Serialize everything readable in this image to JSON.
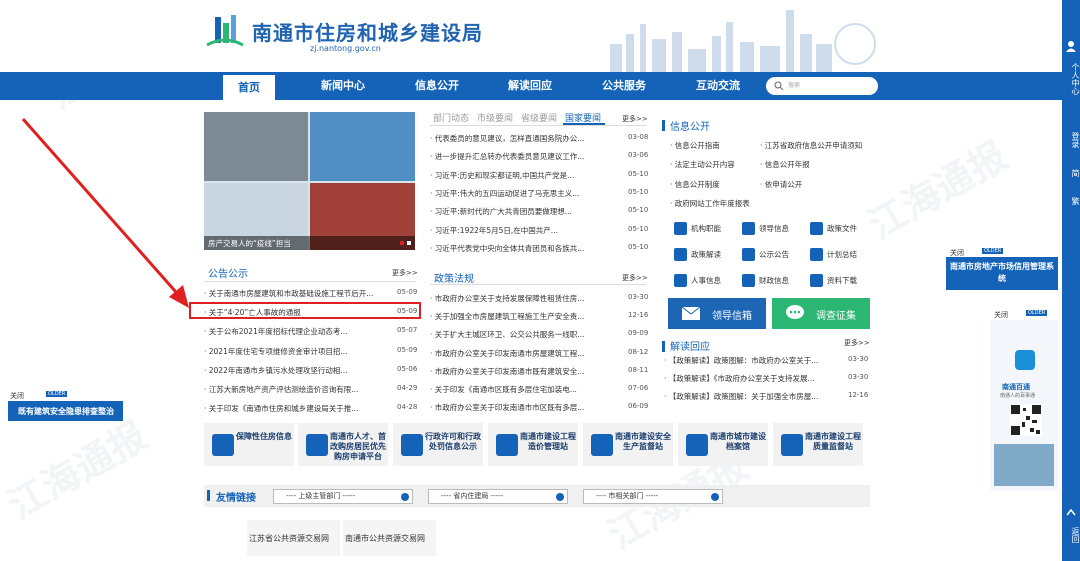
{
  "header": {
    "title": "南通市住房和城乡建设局",
    "domain": "zj.nantong.gov.cn"
  },
  "nav": {
    "items": [
      "首页",
      "新闻中心",
      "信息公开",
      "解读回应",
      "公共服务",
      "互动交流"
    ],
    "search_placeholder": "搜索"
  },
  "rail": {
    "user_center": "个人中心",
    "login": "登录",
    "simplified": "简",
    "traditional": "繁",
    "back": "返回"
  },
  "slider": {
    "caption": "房产交易人的“疫线”担当"
  },
  "notices": {
    "title": "公告公示",
    "more": "更多>>",
    "items": [
      {
        "text": "关于南通市房屋建筑和市政基础设施工程节后开...",
        "date": "05-09"
      },
      {
        "text": "关于“4·20”亡人事故的通报",
        "date": "05-09"
      },
      {
        "text": "关于公布2021年度招标代理企业动态考...",
        "date": "05-07"
      },
      {
        "text": "2021年度住宅专项维修资金审计项目招...",
        "date": "05-09"
      },
      {
        "text": "2022年南通市乡镇污水处理攻坚行动相...",
        "date": "05-06"
      },
      {
        "text": "江苏大新房地产资产评估测绘造价咨询有限...",
        "date": "04-29"
      },
      {
        "text": "关于印发《南通市住房和城乡建设局关于推...",
        "date": "04-28"
      }
    ]
  },
  "news": {
    "tabs": [
      "部门动态",
      "市级要闻",
      "省级要闻",
      "国家要闻"
    ],
    "more": "更多>>",
    "items": [
      {
        "text": "代表委员的意见建议，怎样直通国务院办公...",
        "date": "03-08"
      },
      {
        "text": "进一步提升汇总转办代表委员意见建议工作...",
        "date": "03-06"
      },
      {
        "text": "习近平:历史和现实都证明,中国共产党是...",
        "date": "05-10"
      },
      {
        "text": "习近平:伟大的五四运动促进了马克思主义...",
        "date": "05-10"
      },
      {
        "text": "习近平:新时代的广大共青团员要做理想...",
        "date": "05-10"
      },
      {
        "text": "习近平:1922年5月5日,在中国共产...",
        "date": "05-10"
      },
      {
        "text": "习近平代表党中央向全体共青团员和各族共...",
        "date": "05-10"
      }
    ]
  },
  "policy": {
    "title": "政策法规",
    "more": "更多>>",
    "items": [
      {
        "text": "市政府办公室关于支持发展保障性租赁住房...",
        "date": "03-30"
      },
      {
        "text": "关于加强全市房屋建筑工程施工生产安全责...",
        "date": "12-16"
      },
      {
        "text": "关于扩大主城区环卫、公交公共服务一线职...",
        "date": "09-09"
      },
      {
        "text": "市政府办公室关于印发南通市房屋建筑工程...",
        "date": "08-12"
      },
      {
        "text": "市政府办公室关于印发南通市既有建筑安全...",
        "date": "08-11"
      },
      {
        "text": "关于印发《南通市区既有多层住宅加装电...",
        "date": "07-06"
      },
      {
        "text": "市政府办公室关于印发南通市市区既有多层...",
        "date": "06-09"
      }
    ]
  },
  "info": {
    "title": "信息公开",
    "links": [
      "信息公开指南",
      "江苏省政府信息公开申请须知",
      "法定主动公开内容",
      "信息公开年报",
      "信息公开制度",
      "依申请公开",
      "政府网站工作年度报表"
    ],
    "grid": [
      "机构职能",
      "领导信息",
      "政策文件",
      "政策解读",
      "公示公告",
      "计划总结",
      "人事信息",
      "财政信息",
      "资料下载"
    ],
    "mailbox": "领导信箱",
    "survey": "调查征集"
  },
  "interpret": {
    "title": "解读回应",
    "more": "更多>>",
    "items": [
      {
        "text": "【政策解读】政策图解：市政府办公室关于...",
        "date": "03-30"
      },
      {
        "text": "【政策解读】《市政府办公室关于支持发展...",
        "date": "03-30"
      },
      {
        "text": "【政策解读】政策图解：关于加强全市房屋...",
        "date": "12-16"
      }
    ]
  },
  "services": [
    "保障性住房信息",
    "南通市人才、首改购房居民优先购房申请平台",
    "行政许可和行政处罚信息公示",
    "南通市建设工程造价管理站",
    "南通市建设安全生产监督站",
    "南通市城市建设档案馆",
    "南通市建设工程质量监督站"
  ],
  "links": {
    "title": "友情链接",
    "selects": [
      "---- 上级主管部门 -----",
      "---- 省内住建局 -----",
      "---- 市相关部门 -----"
    ],
    "items": [
      "江苏省公共资源交易网",
      "南通市公共资源交易网"
    ]
  },
  "float_left": {
    "close": "关闭",
    "badge": "OLDER",
    "label": "既有建筑安全隐患排查整治"
  },
  "float_right": {
    "close": "关闭",
    "badge": "OLDER",
    "label": "南通市房地产市场信用管理系统",
    "app_name": "南通百通",
    "app_sub": "南通人的百事通"
  },
  "float_right2": {
    "close": "关闭",
    "badge": "OLDER"
  },
  "colors": {
    "brand": "#1463b8",
    "highlight": "#e02020",
    "green": "#2bb673"
  }
}
